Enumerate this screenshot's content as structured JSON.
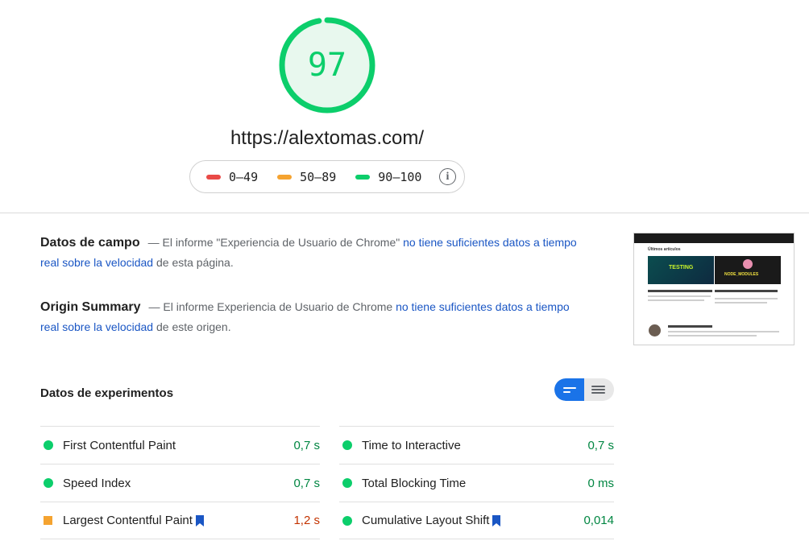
{
  "score": {
    "value": "97",
    "fraction": 0.97,
    "color": "#0cce6b"
  },
  "url": "https://alextomas.com/",
  "legend": {
    "items": [
      {
        "label": "0–49",
        "color": "#e94a47"
      },
      {
        "label": "50–89",
        "color": "#f5a330"
      },
      {
        "label": "90–100",
        "color": "#0cce6b"
      }
    ],
    "info_icon": "info-icon"
  },
  "field_data": {
    "title": "Datos de campo",
    "prefix": "— El informe \"Experiencia de Usuario de Chrome\" ",
    "link": "no tiene suficientes datos a tiempo real sobre la velocidad",
    "suffix": " de esta página."
  },
  "origin_summary": {
    "title": "Origin Summary",
    "prefix": "— El informe Experiencia de Usuario de Chrome ",
    "link": "no tiene suficientes datos a tiempo real sobre la velocidad",
    "suffix": " de este origen."
  },
  "thumbnail": {
    "section": "Últimos artículos",
    "card1": "TESTING",
    "card2": "NODE_MODULES"
  },
  "lab_data": {
    "title": "Datos de experimentos",
    "toggle": {
      "left_icon": "compact-view-icon",
      "right_icon": "expanded-view-icon"
    }
  },
  "metrics": {
    "left": [
      {
        "name": "First Contentful Paint",
        "value": "0,7 s",
        "status": "pass",
        "flag": false
      },
      {
        "name": "Speed Index",
        "value": "0,7 s",
        "status": "pass",
        "flag": false
      },
      {
        "name": "Largest Contentful Paint",
        "value": "1,2 s",
        "status": "average",
        "flag": true
      }
    ],
    "right": [
      {
        "name": "Time to Interactive",
        "value": "0,7 s",
        "status": "pass",
        "flag": false
      },
      {
        "name": "Total Blocking Time",
        "value": "0 ms",
        "status": "pass",
        "flag": false
      },
      {
        "name": "Cumulative Layout Shift",
        "value": "0,014",
        "status": "pass",
        "flag": true
      }
    ]
  },
  "colors": {
    "pass": "#0cce6b",
    "pass_text": "#018642",
    "average": "#f5a330",
    "average_text": "#c33300",
    "link": "#1a56c4",
    "accent": "#1a73e8"
  }
}
